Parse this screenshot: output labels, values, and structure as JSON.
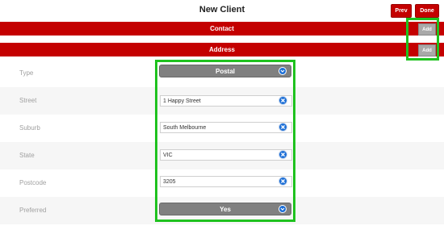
{
  "header": {
    "title": "New Client",
    "prev_label": "Prev",
    "done_label": "Done"
  },
  "sections": {
    "contact": {
      "label": "Contact",
      "add_label": "Add"
    },
    "address": {
      "label": "Address",
      "add_label": "Add"
    }
  },
  "form": {
    "type": {
      "label": "Type",
      "value": "Postal"
    },
    "street": {
      "label": "Street",
      "value": "1 Happy Street"
    },
    "suburb": {
      "label": "Suburb",
      "value": "South Melbourne"
    },
    "state": {
      "label": "State",
      "value": "VIC"
    },
    "postcode": {
      "label": "Postcode",
      "value": "3205"
    },
    "preferred": {
      "label": "Preferred",
      "value": "Yes"
    }
  },
  "colors": {
    "accent_red": "#c40000",
    "highlight_green": "#1fc21f",
    "select_gray": "#808080",
    "icon_blue": "#1d6fd6"
  }
}
